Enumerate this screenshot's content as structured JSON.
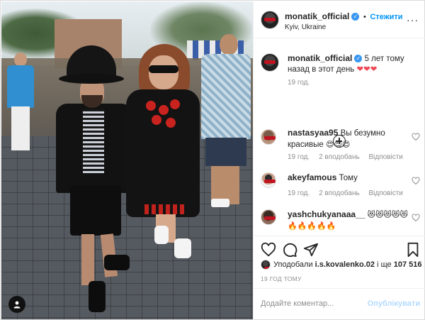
{
  "post": {
    "username": "monatik_official",
    "follow_label": "Стежити",
    "location": "Kyiv, Ukraine",
    "caption": {
      "text": "5 лет тому назад в этот день",
      "hearts": "❤❤❤",
      "time": "19 год."
    },
    "comments": [
      {
        "user": "nastasyaa95",
        "text": "Вы безумно красивые",
        "emoji": "😍😍😍",
        "time": "19 год.",
        "likes": "2 вподобань",
        "reply": "Відповісти"
      },
      {
        "user": "akeyfamous",
        "text": "Тому",
        "emoji": "",
        "time": "19 год.",
        "likes": "2 вподобань",
        "reply": "Відповісти"
      },
      {
        "user": "yashchukyanaaa__",
        "text": "",
        "emoji": "😻😻😻😻😻🔥🔥🔥🔥🔥",
        "time": "",
        "likes": "",
        "reply": ""
      }
    ],
    "likes_prefix": "Уподобали",
    "likes_user": "i.s.kovalenko.02",
    "likes_and": "і ще",
    "likes_count": "107 516",
    "timestamp": "19 ГОД ТОМУ",
    "comment_placeholder": "Додайте коментар...",
    "publish_label": "Опублікувати"
  },
  "icons": {
    "like": "heart-outline-icon",
    "comment": "comment-bubble-icon",
    "share": "paper-plane-icon",
    "save": "bookmark-icon",
    "tag": "user-tag-icon",
    "load_more": "plus-circle-icon"
  },
  "colors": {
    "accent": "#0095f6",
    "verified": "#3897f0",
    "heart_red": "#ed4956",
    "muted": "#8e8e8e"
  }
}
